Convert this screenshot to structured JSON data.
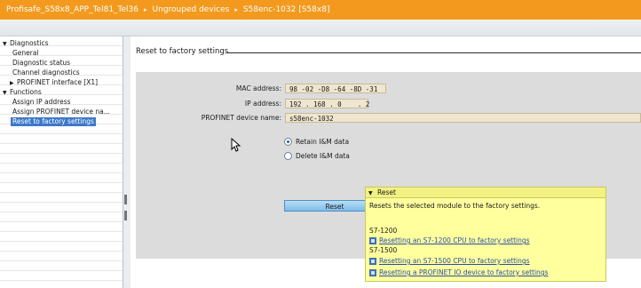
{
  "breadcrumb": {
    "items": [
      "Profisafe_S58x8_APP_Tel81_Tel36",
      "Ungrouped devices",
      "S58enc-1032 [S58x8]"
    ],
    "separator": "▸"
  },
  "nav_tree": {
    "items": [
      {
        "label": "Diagnostics",
        "expanded": true
      },
      {
        "label": "General"
      },
      {
        "label": "Diagnostic status"
      },
      {
        "label": "Channel diagnostics"
      },
      {
        "label": "PROFINET interface [X1]",
        "collapsed": true
      },
      {
        "label": "Functions",
        "expanded": true
      },
      {
        "label": "Assign IP address"
      },
      {
        "label": "Assign PROFINET device na..."
      },
      {
        "label": "Reset to factory settings",
        "selected": true
      }
    ]
  },
  "section": {
    "title": "Reset to factory settings"
  },
  "form": {
    "mac_label": "MAC address:",
    "mac_value": "98 -02 -D8 -64 -8D -31",
    "ip_label": "IP address:",
    "ip_value": "192 . 168 . 0    . 2",
    "device_name_label": "PROFINET device name:",
    "device_name_value": "s58enc-1032"
  },
  "options": {
    "retain_label": "Retain I&M data",
    "delete_label": "Delete I&M data",
    "selected": "retain"
  },
  "reset_button": {
    "label": "Reset"
  },
  "tooltip": {
    "header": "Reset",
    "description": "Resets the selected module to the factory settings.",
    "groups": [
      {
        "name": "S7-1200",
        "links": [
          "Resetting an S7-1200 CPU to factory settings"
        ]
      },
      {
        "name": "S7-1500",
        "links": [
          "Resetting an S7-1500 CPU to factory settings",
          "Resetting a PROFINET IO device to factory settings"
        ]
      }
    ]
  },
  "colors": {
    "titlebar": "#f39a1e",
    "selection": "#3c78c8",
    "field_bg": "#efe6cf",
    "tooltip_bg": "#ffff9e"
  },
  "icons": {
    "expand": "triangle-down-icon",
    "collapse": "triangle-right-icon",
    "help_link": "help-link-icon",
    "cursor": "mouse-pointer-icon"
  }
}
